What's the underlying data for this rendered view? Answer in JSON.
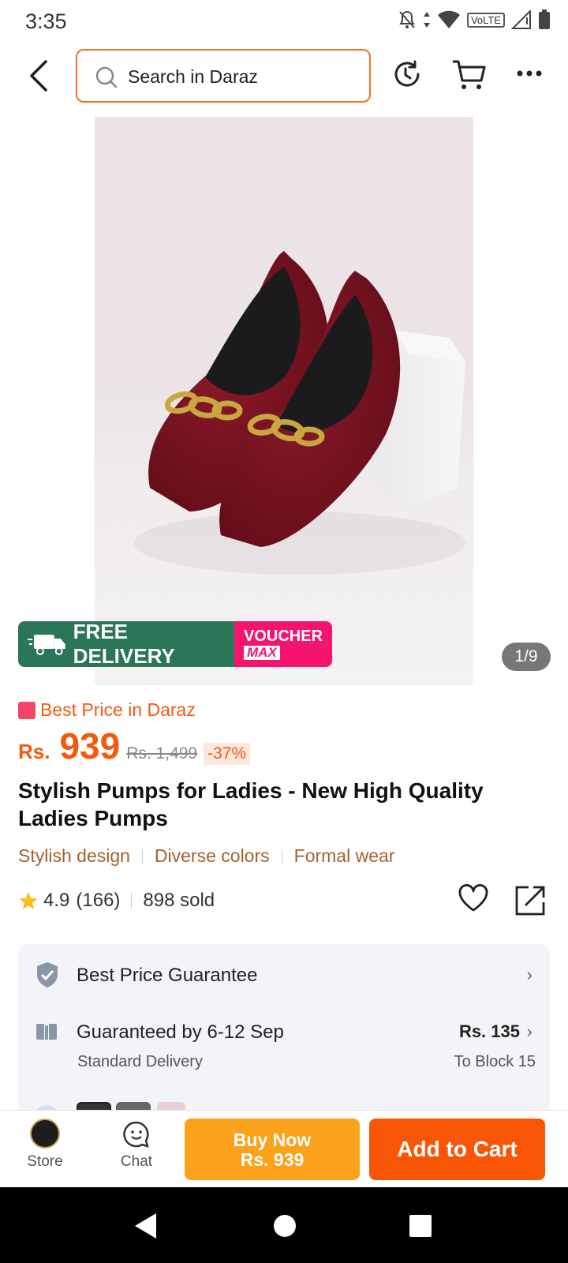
{
  "status_bar": {
    "time": "3:35",
    "network": "VoLTE"
  },
  "header": {
    "search_placeholder": "Search in Daraz"
  },
  "gallery": {
    "counter": "1/9"
  },
  "promo": {
    "free_delivery": "FREE DELIVERY",
    "free_tag": "FREE",
    "voucher_line1": "VOUCHER",
    "voucher_line2": "MAX"
  },
  "product": {
    "best_price_label": "Best Price in Daraz",
    "currency": "Rs.",
    "price": "939",
    "original_price": "Rs. 1,499",
    "discount": "-37%",
    "title": "Stylish Pumps for Ladies - New High Quality Ladies Pumps",
    "features": [
      "Stylish design",
      "Diverse colors",
      "Formal wear"
    ],
    "rating": "4.9",
    "reviews": "(166)",
    "sold": "898 sold"
  },
  "info_card": {
    "guarantee": "Best Price Guarantee",
    "delivery_title": "Guaranteed by 6-12 Sep",
    "delivery_sub": "Standard Delivery",
    "delivery_fee": "Rs. 135",
    "delivery_location": "To Block 15"
  },
  "bottom_bar": {
    "store": "Store",
    "chat": "Chat",
    "buy_now_line1": "Buy Now",
    "buy_now_line2": "Rs. 939",
    "add_to_cart": "Add to Cart"
  },
  "colors": {
    "accent": "#f57224",
    "price": "#f45a0e",
    "buy_now": "#faa21b",
    "add_to_cart": "#f85606",
    "delivery_banner": "#2b7656",
    "voucher": "#f5146e"
  }
}
